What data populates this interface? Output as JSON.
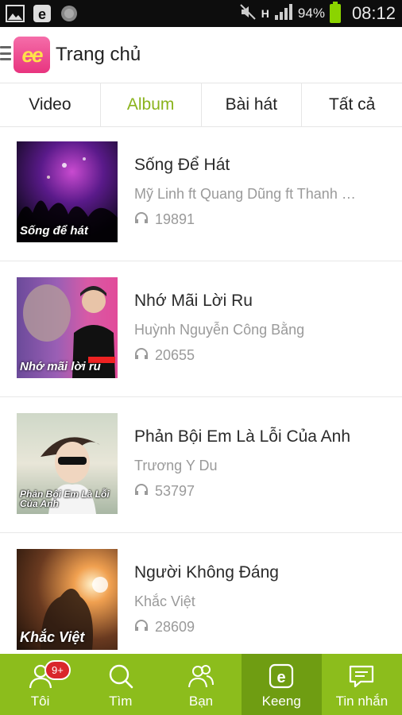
{
  "status_bar": {
    "battery": "94%",
    "time": "08:12",
    "network": "H"
  },
  "header": {
    "logo": "ee",
    "title": "Trang chủ"
  },
  "tabs": [
    {
      "label": "Video",
      "active": false
    },
    {
      "label": "Album",
      "active": true
    },
    {
      "label": "Bài hát",
      "active": false
    },
    {
      "label": "Tất cả",
      "active": false
    }
  ],
  "albums": [
    {
      "title": "Sống Để Hát",
      "artist": "Mỹ Linh ft Quang Dũng ft Thanh …",
      "listens": "19891",
      "cover_text": "Sống để hát"
    },
    {
      "title": "Nhớ Mãi Lời Ru",
      "artist": "Huỳnh Nguyễn Công Bằng",
      "listens": "20655",
      "cover_text": "Nhớ mãi lời ru"
    },
    {
      "title": "Phản Bội Em Là Lỗi Của Anh",
      "artist": "Trương Y Du",
      "listens": "53797",
      "cover_text": "Phản Bội Em Là Lỗi Của Anh"
    },
    {
      "title": "Người Không Đáng",
      "artist": "Khắc Việt",
      "listens": "28609",
      "cover_text": "Khắc Việt"
    }
  ],
  "bottom_nav": [
    {
      "label": "Tôi",
      "icon": "user-icon",
      "badge": "9+",
      "active": false
    },
    {
      "label": "Tìm",
      "icon": "search-icon",
      "active": false
    },
    {
      "label": "Bạn",
      "icon": "friends-icon",
      "active": false
    },
    {
      "label": "Keeng",
      "icon": "keeng-icon",
      "active": true
    },
    {
      "label": "Tin nhắn",
      "icon": "message-icon",
      "active": false
    }
  ],
  "colors": {
    "brand_green": "#8cbd1c",
    "active_tab": "#8ab31c",
    "badge_red": "#d9262b"
  }
}
